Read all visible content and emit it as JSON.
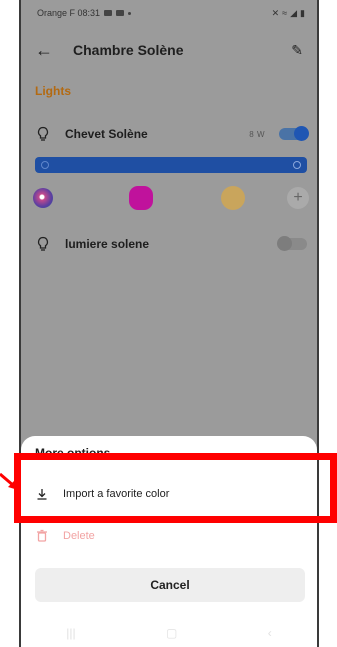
{
  "status_bar": {
    "carrier_time": "Orange F 08:31"
  },
  "header": {
    "title": "Chambre Solène"
  },
  "section": {
    "label": "Lights"
  },
  "lights": [
    {
      "name": "Chevet Solène",
      "power": "8 W",
      "on": true
    },
    {
      "name": "lumiere solene",
      "power": "",
      "on": false
    }
  ],
  "colors": {
    "accent": "#b36a12",
    "slider": "#1f4fa3",
    "swatch_magenta": "#c0129c",
    "swatch_gold": "#c9a55c",
    "highlight": "#ff0000"
  },
  "sheet": {
    "title": "More options",
    "items": [
      {
        "label": "Import a favorite color",
        "icon": "download-icon"
      },
      {
        "label": "Delete",
        "icon": "trash-icon"
      }
    ],
    "cancel_label": "Cancel"
  }
}
